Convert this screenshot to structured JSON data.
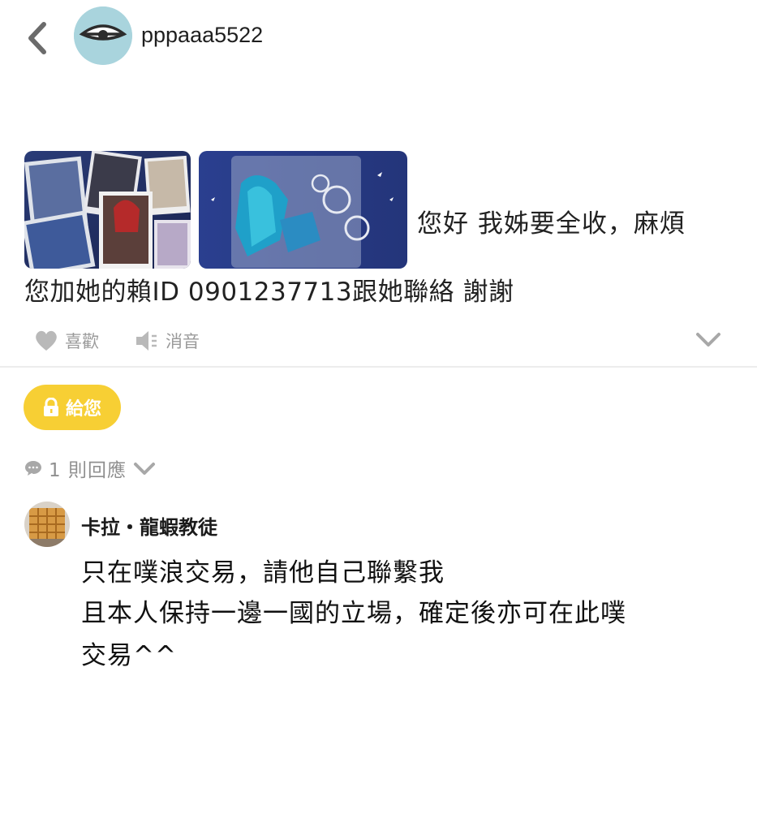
{
  "header": {
    "username": "pppaaa5522",
    "back_icon": "chevron-left-icon",
    "avatar_icon": "eye-avatar-icon",
    "avatar_color": "#a9d4dd"
  },
  "post": {
    "images": [
      {
        "name": "photo-cards-image"
      },
      {
        "name": "acrylic-keychain-image"
      }
    ],
    "text_line1": "您好 我姊要全收，麻煩",
    "text_line2": "您加她的賴ID 0901237713跟她聯絡 謝謝"
  },
  "actions": {
    "like_label": "喜歡",
    "like_icon": "heart-icon",
    "mute_label": "消音",
    "mute_icon": "speaker-mute-icon",
    "expand_icon": "chevron-down-icon"
  },
  "unlock": {
    "label": "給您",
    "icon": "lock-icon",
    "color": "#f7cf34"
  },
  "responses": {
    "label": "1 則回應",
    "icon": "speech-bubble-icon"
  },
  "comment": {
    "author": "卡拉・龍蝦教徒",
    "lines": [
      "只在噗浪交易，請他自己聯繫我",
      "且本人保持一邊一國的立場，確定後亦可在此噗",
      "交易^^"
    ]
  }
}
